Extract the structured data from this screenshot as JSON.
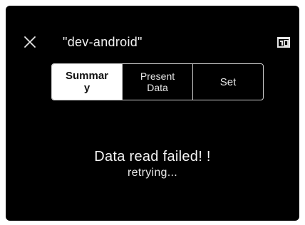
{
  "status_bar": {
    "left_text": "",
    "right_text": ""
  },
  "header": {
    "close_icon": "close-icon",
    "title": "\"dev-android\"",
    "action_icon": "calendar-icon"
  },
  "tabs": [
    {
      "label": "Summar\ny",
      "active": true
    },
    {
      "label": "Present\nData",
      "active": false
    },
    {
      "label": "Set",
      "active": false
    }
  ],
  "message": {
    "main": "Data read failed! !",
    "sub": "retrying..."
  }
}
